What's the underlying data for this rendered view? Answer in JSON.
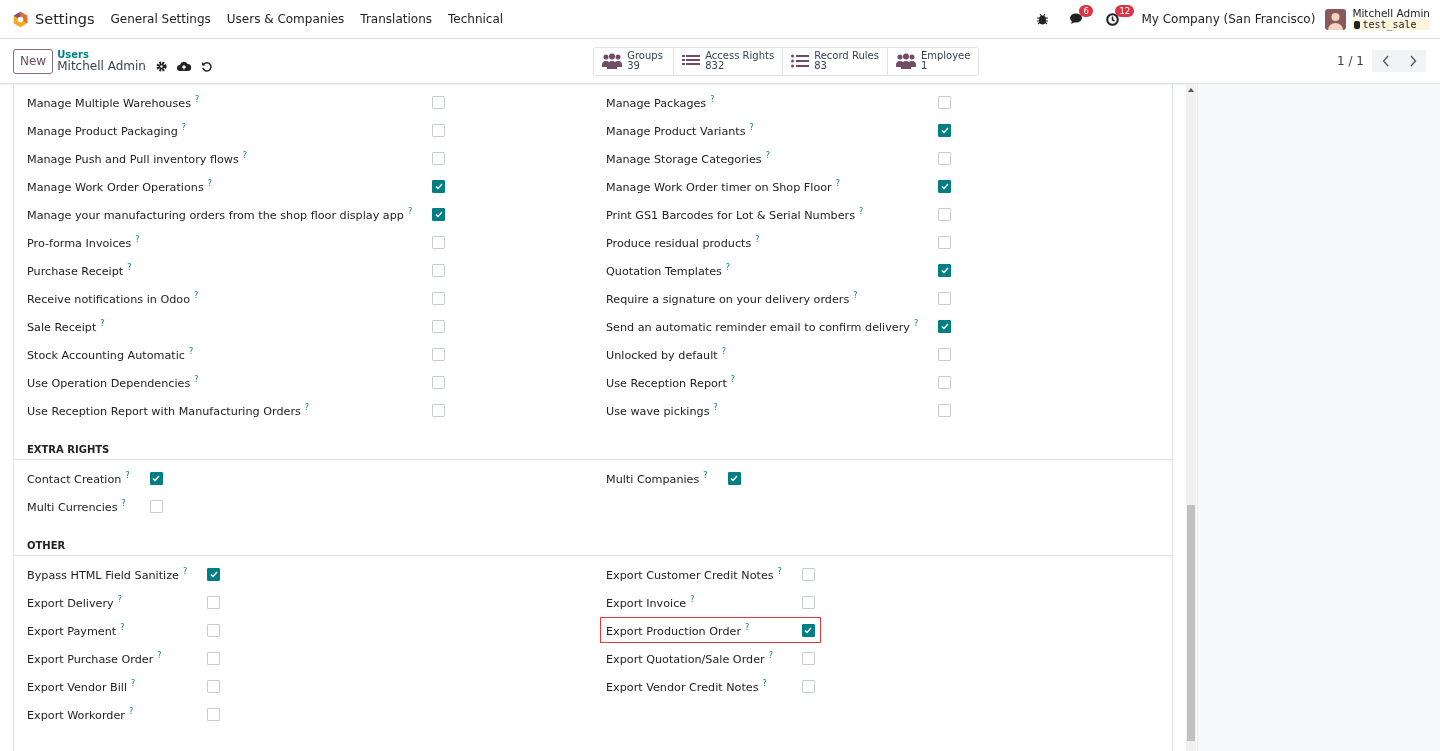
{
  "navbar": {
    "app": "Settings",
    "menu": [
      "General Settings",
      "Users & Companies",
      "Translations",
      "Technical"
    ],
    "messages_count": "6",
    "activities_count": "12",
    "company": "My Company (San Francisco)",
    "user": "Mitchell Admin",
    "database": "test_sale"
  },
  "control_panel": {
    "new_button": "New",
    "breadcrumb": "Users",
    "record": "Mitchell Admin",
    "smart_buttons": [
      {
        "kind": "people",
        "label": "Groups",
        "count": "39"
      },
      {
        "kind": "list",
        "label": "Access Rights",
        "count": "832"
      },
      {
        "kind": "bullets",
        "label": "Record Rules",
        "count": "83"
      },
      {
        "kind": "people",
        "label": "Employee",
        "count": "1"
      }
    ],
    "pager": "1 / 1"
  },
  "sections": [
    {
      "columns": [
        [
          {
            "label": "Manage Multiple Warehouses",
            "help": "?",
            "checked": false,
            "highlighted": false
          },
          {
            "label": "Manage Product Packaging",
            "help": "?",
            "checked": false,
            "highlighted": false
          },
          {
            "label": "Manage Push and Pull inventory flows",
            "help": "?",
            "checked": false,
            "highlighted": false
          },
          {
            "label": "Manage Work Order Operations",
            "help": "?",
            "checked": true,
            "highlighted": false
          },
          {
            "label": "Manage your manufacturing orders from the shop floor display app",
            "help": "?",
            "checked": true,
            "highlighted": false
          },
          {
            "label": "Pro-forma Invoices",
            "help": "?",
            "checked": false,
            "highlighted": false
          },
          {
            "label": "Purchase Receipt",
            "help": "?",
            "checked": false,
            "highlighted": false
          },
          {
            "label": "Receive notifications in Odoo",
            "help": "?",
            "checked": false,
            "highlighted": false
          },
          {
            "label": "Sale Receipt",
            "help": "?",
            "checked": false,
            "highlighted": false
          },
          {
            "label": "Stock Accounting Automatic",
            "help": "?",
            "checked": false,
            "highlighted": false
          },
          {
            "label": "Use Operation Dependencies",
            "help": "?",
            "checked": false,
            "highlighted": false
          },
          {
            "label": "Use Reception Report with Manufacturing Orders",
            "help": "?",
            "checked": false,
            "highlighted": false
          }
        ],
        [
          {
            "label": "Manage Packages",
            "help": "?",
            "checked": false,
            "highlighted": false
          },
          {
            "label": "Manage Product Variants",
            "help": "?",
            "checked": true,
            "highlighted": false
          },
          {
            "label": "Manage Storage Categories",
            "help": "?",
            "checked": false,
            "highlighted": false
          },
          {
            "label": "Manage Work Order timer on Shop Floor",
            "help": "?",
            "checked": true,
            "highlighted": false
          },
          {
            "label": "Print GS1 Barcodes for Lot & Serial Numbers",
            "help": "?",
            "checked": false,
            "highlighted": false
          },
          {
            "label": "Produce residual products",
            "help": "?",
            "checked": false,
            "highlighted": false
          },
          {
            "label": "Quotation Templates",
            "help": "?",
            "checked": true,
            "highlighted": false
          },
          {
            "label": "Require a signature on your delivery orders",
            "help": "?",
            "checked": false,
            "highlighted": false
          },
          {
            "label": "Send an automatic reminder email to confirm delivery",
            "help": "?",
            "checked": true,
            "highlighted": false
          },
          {
            "label": "Unlocked by default",
            "help": "?",
            "checked": false,
            "highlighted": false
          },
          {
            "label": "Use Reception Report",
            "help": "?",
            "checked": false,
            "highlighted": false
          },
          {
            "label": "Use wave pickings",
            "help": "?",
            "checked": false,
            "highlighted": false
          }
        ]
      ]
    },
    {
      "title": "EXTRA RIGHTS",
      "columns": [
        [
          {
            "label": "Contact Creation",
            "help": "?",
            "checked": true,
            "highlighted": false
          },
          {
            "label": "Multi Currencies",
            "help": "?",
            "checked": false,
            "highlighted": false
          }
        ],
        [
          {
            "label": "Multi Companies",
            "help": "?",
            "checked": true,
            "highlighted": false
          }
        ]
      ]
    },
    {
      "title": "OTHER",
      "columns": [
        [
          {
            "label": "Bypass HTML Field Sanitize",
            "help": "?",
            "checked": true,
            "highlighted": false
          },
          {
            "label": "Export Delivery",
            "help": "?",
            "checked": false,
            "highlighted": false
          },
          {
            "label": "Export Payment",
            "help": "?",
            "checked": false,
            "highlighted": false
          },
          {
            "label": "Export Purchase Order",
            "help": "?",
            "checked": false,
            "highlighted": false
          },
          {
            "label": "Export Vendor Bill",
            "help": "?",
            "checked": false,
            "highlighted": false
          },
          {
            "label": "Export Workorder",
            "help": "?",
            "checked": false,
            "highlighted": false
          }
        ],
        [
          {
            "label": "Export Customer Credit Notes",
            "help": "?",
            "checked": false,
            "highlighted": false
          },
          {
            "label": "Export Invoice",
            "help": "?",
            "checked": false,
            "highlighted": false
          },
          {
            "label": "Export Production Order",
            "help": "?",
            "checked": true,
            "highlighted": true
          },
          {
            "label": "Export Quotation/Sale Order",
            "help": "?",
            "checked": false,
            "highlighted": false
          },
          {
            "label": "Export Vendor Credit Notes",
            "help": "?",
            "checked": false,
            "highlighted": false
          }
        ]
      ]
    }
  ]
}
